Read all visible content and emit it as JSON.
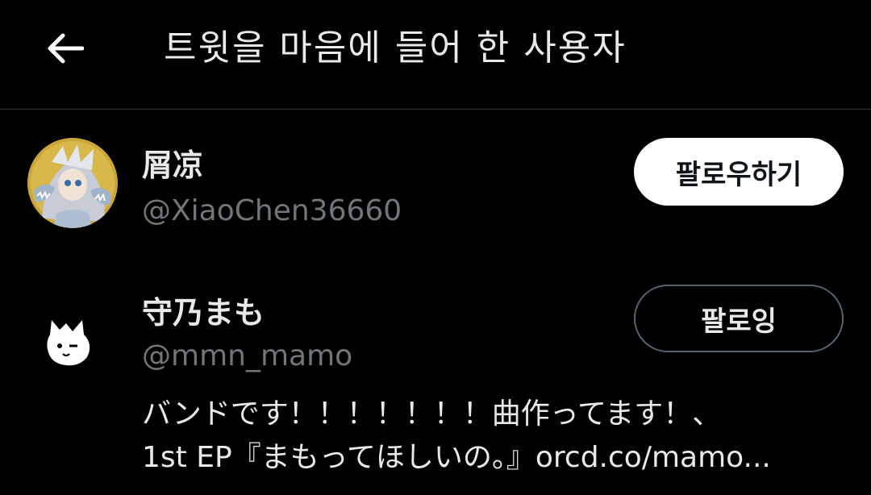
{
  "header": {
    "title": "트윗을 마음에 들어 한 사용자",
    "back_icon": "arrow-left-icon"
  },
  "users": [
    {
      "display_name": "屑凉",
      "handle": "@XiaoChen36660",
      "button_label": "팔로우하기",
      "avatar": "anime-character-avatar"
    },
    {
      "display_name": "守乃まも",
      "handle": "@mmn_mamo",
      "bio_line1": "バンドです！！！！！！！曲作ってます！、",
      "bio_line2": "1st EP『まもってほしいの。』orcd.co/mamo...",
      "button_label": "팔로잉",
      "avatar": "white-cat-doodle-avatar"
    }
  ],
  "colors": {
    "background": "#000000",
    "text_primary": "#e7e9ea",
    "text_secondary": "#71767b",
    "divider": "#2f3336",
    "follow_button_bg": "#ffffff",
    "following_button_border": "#536471"
  }
}
